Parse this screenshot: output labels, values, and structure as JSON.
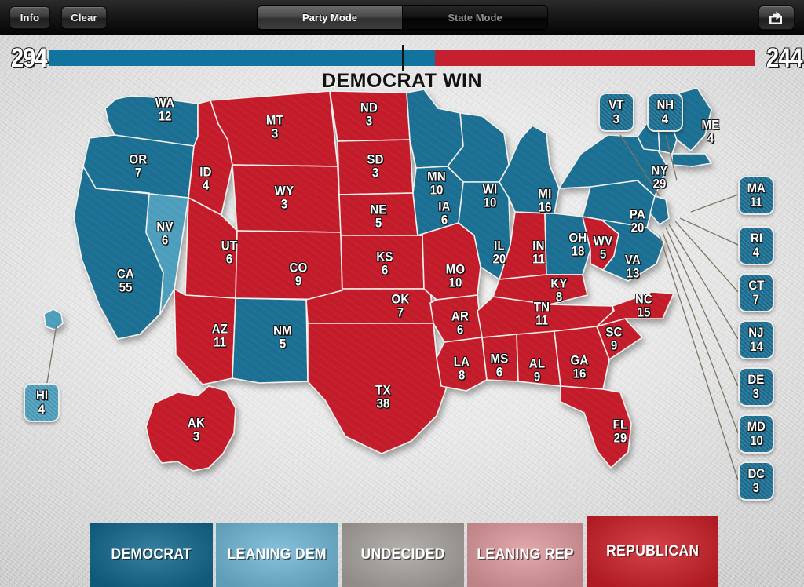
{
  "toolbar": {
    "info_label": "Info",
    "clear_label": "Clear",
    "share_icon": "share-icon",
    "segments": [
      {
        "label": "Party Mode",
        "selected": true
      },
      {
        "label": "State Mode",
        "selected": false
      }
    ]
  },
  "scoreboard": {
    "dem_count": "294",
    "rep_count": "244",
    "result_label": "DEMOCRAT WIN",
    "total_votes": 538,
    "majority": 270,
    "dem_color": "#10749e",
    "rep_color": "#c4202f"
  },
  "colors": {
    "democrat": "#1b6f93",
    "leaning_dem": "#4e9fbd",
    "undecided": "#a9a49f",
    "leaning_rep": "#d98f93",
    "republican": "#c41f2c"
  },
  "legend": {
    "items": [
      {
        "label": "DEMOCRAT",
        "color": "#12678c",
        "text_color": "#ffffff",
        "selected": false
      },
      {
        "label": "LEANING DEM",
        "color": "#6fb6d4",
        "text_color": "#ffffff",
        "selected": false
      },
      {
        "label": "UNDECIDED",
        "color": "#a7a29d",
        "text_color": "#ffffff",
        "selected": false
      },
      {
        "label": "LEANING REP",
        "color": "#dd989c",
        "text_color": "#ffffff",
        "selected": false
      },
      {
        "label": "REPUBLICAN",
        "color": "#cc1f28",
        "text_color": "#ffffff",
        "selected": true
      }
    ]
  },
  "map": {
    "states": [
      {
        "code": "WA",
        "votes": "12",
        "party": "democrat"
      },
      {
        "code": "OR",
        "votes": "7",
        "party": "democrat"
      },
      {
        "code": "CA",
        "votes": "55",
        "party": "democrat"
      },
      {
        "code": "NV",
        "votes": "6",
        "party": "leaning_dem"
      },
      {
        "code": "ID",
        "votes": "4",
        "party": "republican"
      },
      {
        "code": "MT",
        "votes": "3",
        "party": "republican"
      },
      {
        "code": "WY",
        "votes": "3",
        "party": "republican"
      },
      {
        "code": "UT",
        "votes": "6",
        "party": "republican"
      },
      {
        "code": "AZ",
        "votes": "11",
        "party": "republican"
      },
      {
        "code": "NM",
        "votes": "5",
        "party": "democrat"
      },
      {
        "code": "CO",
        "votes": "9",
        "party": "republican"
      },
      {
        "code": "ND",
        "votes": "3",
        "party": "republican"
      },
      {
        "code": "SD",
        "votes": "3",
        "party": "republican"
      },
      {
        "code": "NE",
        "votes": "5",
        "party": "republican"
      },
      {
        "code": "KS",
        "votes": "6",
        "party": "republican"
      },
      {
        "code": "OK",
        "votes": "7",
        "party": "republican"
      },
      {
        "code": "TX",
        "votes": "38",
        "party": "republican"
      },
      {
        "code": "MN",
        "votes": "10",
        "party": "democrat"
      },
      {
        "code": "IA",
        "votes": "6",
        "party": "democrat"
      },
      {
        "code": "MO",
        "votes": "10",
        "party": "republican"
      },
      {
        "code": "AR",
        "votes": "6",
        "party": "republican"
      },
      {
        "code": "LA",
        "votes": "8",
        "party": "republican"
      },
      {
        "code": "WI",
        "votes": "10",
        "party": "democrat"
      },
      {
        "code": "IL",
        "votes": "20",
        "party": "democrat"
      },
      {
        "code": "MS",
        "votes": "6",
        "party": "republican"
      },
      {
        "code": "MI",
        "votes": "16",
        "party": "democrat"
      },
      {
        "code": "IN",
        "votes": "11",
        "party": "republican"
      },
      {
        "code": "OH",
        "votes": "18",
        "party": "democrat"
      },
      {
        "code": "KY",
        "votes": "8",
        "party": "republican"
      },
      {
        "code": "TN",
        "votes": "11",
        "party": "republican"
      },
      {
        "code": "AL",
        "votes": "9",
        "party": "republican"
      },
      {
        "code": "GA",
        "votes": "16",
        "party": "republican"
      },
      {
        "code": "FL",
        "votes": "29",
        "party": "republican"
      },
      {
        "code": "SC",
        "votes": "9",
        "party": "republican"
      },
      {
        "code": "NC",
        "votes": "15",
        "party": "republican"
      },
      {
        "code": "WV",
        "votes": "5",
        "party": "republican"
      },
      {
        "code": "VA",
        "votes": "13",
        "party": "democrat"
      },
      {
        "code": "PA",
        "votes": "20",
        "party": "democrat"
      },
      {
        "code": "NY",
        "votes": "29",
        "party": "democrat"
      },
      {
        "code": "ME",
        "votes": "4",
        "party": "democrat"
      },
      {
        "code": "AK",
        "votes": "3",
        "party": "republican"
      }
    ],
    "callouts": [
      {
        "code": "VT",
        "votes": "3",
        "party": "democrat"
      },
      {
        "code": "NH",
        "votes": "4",
        "party": "democrat"
      },
      {
        "code": "MA",
        "votes": "11",
        "party": "democrat"
      },
      {
        "code": "RI",
        "votes": "4",
        "party": "democrat"
      },
      {
        "code": "CT",
        "votes": "7",
        "party": "democrat"
      },
      {
        "code": "NJ",
        "votes": "14",
        "party": "democrat"
      },
      {
        "code": "DE",
        "votes": "3",
        "party": "democrat"
      },
      {
        "code": "MD",
        "votes": "10",
        "party": "democrat"
      },
      {
        "code": "DC",
        "votes": "3",
        "party": "democrat"
      },
      {
        "code": "HI",
        "votes": "4",
        "party": "leaning_dem"
      }
    ]
  }
}
